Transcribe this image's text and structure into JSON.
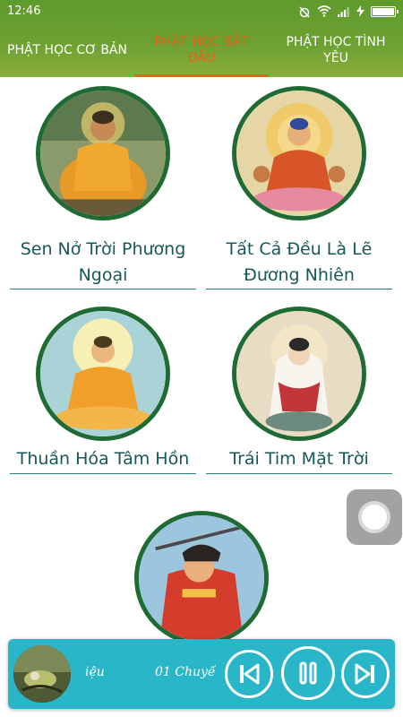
{
  "status_bar": {
    "time": "12:46",
    "icons": [
      "alarm-off-icon",
      "wifi-icon",
      "signal-icon",
      "charging-icon",
      "battery-icon"
    ],
    "battery_level": 1.0
  },
  "tabs": [
    {
      "label": "PHẬT HỌC CƠ BẢN",
      "active": false
    },
    {
      "label": "PHẬT HỌC BẮT ĐẦU",
      "active": true
    },
    {
      "label": "PHẬT HỌC TÌNH YÊU",
      "active": false
    }
  ],
  "items": [
    {
      "title": "Sen Nở Trời Phương Ngoại"
    },
    {
      "title": "Tất Cả Đều Là Lẽ Đương Nhiên"
    },
    {
      "title": "Thuần Hóa Tâm Hồn"
    },
    {
      "title": "Trái Tim Mặt Trời"
    },
    {
      "title": ""
    }
  ],
  "player": {
    "text_left": "iệu",
    "text_right": "01 Chuyế",
    "buttons": [
      "previous-icon",
      "pause-icon",
      "next-icon"
    ]
  },
  "colors": {
    "header_green": "#6ea232",
    "active_tab": "#e8621a",
    "title_teal": "#16585a",
    "ring_green": "#1f6b33",
    "player_bg": "#2ab6c9"
  }
}
